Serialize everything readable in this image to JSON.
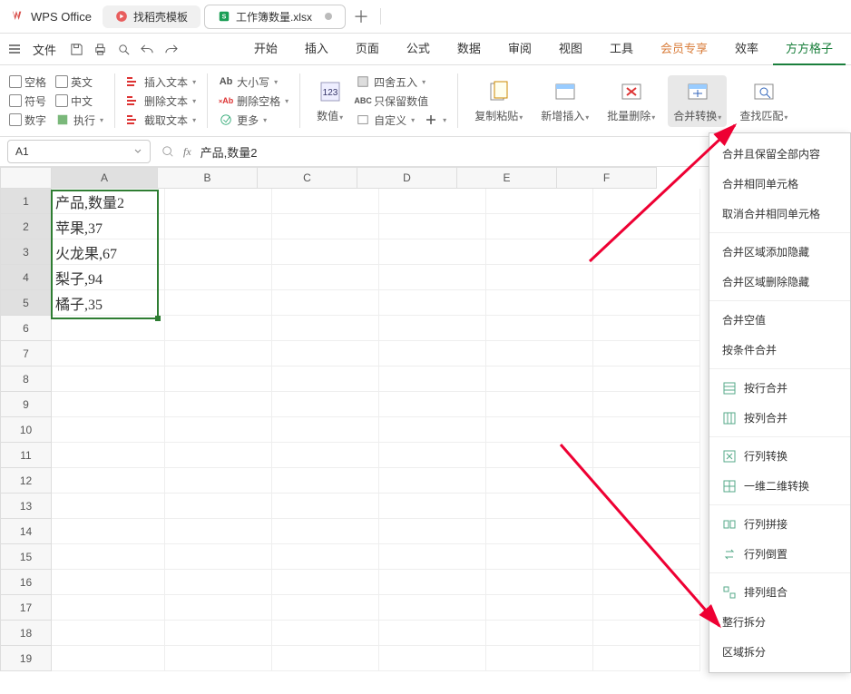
{
  "app_title": "WPS Office",
  "tabs": [
    {
      "label": "找稻壳模板",
      "active": false
    },
    {
      "label": "工作簿数量.xlsx",
      "active": true
    }
  ],
  "file_label": "文件",
  "menu": [
    "开始",
    "插入",
    "页面",
    "公式",
    "数据",
    "审阅",
    "视图",
    "工具",
    "会员专享",
    "效率",
    "方方格子"
  ],
  "ribbon": {
    "chk_col1": [
      "空格",
      "符号",
      "数字"
    ],
    "chk_col2": [
      "英文",
      "中文",
      "执行"
    ],
    "text_ops": [
      "插入文本",
      "删除文本",
      "截取文本"
    ],
    "case_ops": [
      "大小写",
      "删除空格",
      "更多"
    ],
    "num_label": "数值",
    "num_ops": [
      "四舍五入",
      "只保留数值",
      "自定义"
    ],
    "big": [
      "复制粘贴",
      "新增插入",
      "批量删除",
      "合并转换",
      "查找匹配"
    ]
  },
  "namebox": "A1",
  "formula": "产品,数量2",
  "columns": [
    "A",
    "B",
    "C",
    "D",
    "E",
    "F"
  ],
  "cells": {
    "A1": "产品,数量2",
    "A2": "苹果,37",
    "A3": "火龙果,67",
    "A4": "梨子,94",
    "A5": "橘子,35"
  },
  "dropdown": {
    "g1": [
      "合并且保留全部内容",
      "合并相同单元格",
      "取消合并相同单元格"
    ],
    "g2": [
      "合并区域添加隐藏",
      "合并区域删除隐藏"
    ],
    "g3": [
      "合并空值",
      "按条件合并"
    ],
    "g4": [
      "按行合并",
      "按列合并"
    ],
    "g5": [
      "行列转换",
      "一维二维转换"
    ],
    "g6": [
      "行列拼接",
      "行列倒置"
    ],
    "g7": [
      "排列组合",
      "整行拆分",
      "区域拆分"
    ]
  }
}
